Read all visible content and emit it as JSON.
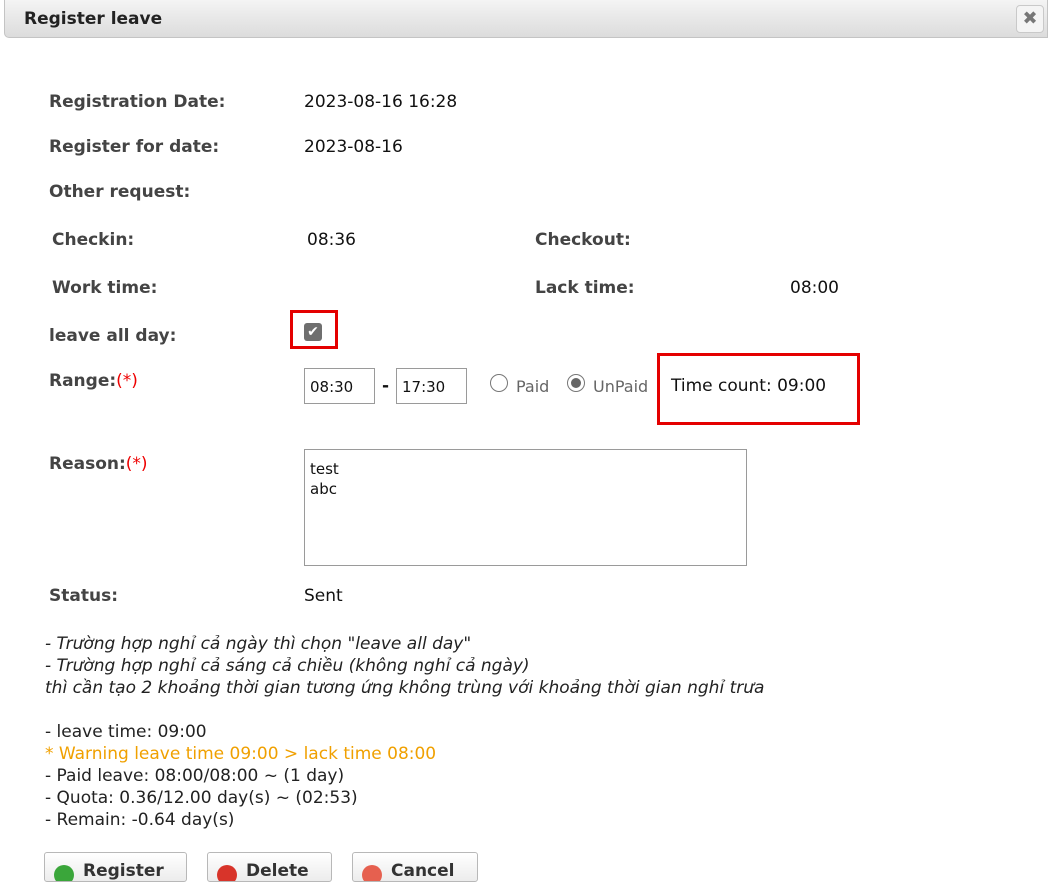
{
  "dialog": {
    "title": "Register leave",
    "close_glyph": "✖"
  },
  "form": {
    "registration_date_label": "Registration Date:",
    "registration_date_value": "2023-08-16 16:28",
    "register_for_date_label": "Register for date:",
    "register_for_date_value": "2023-08-16",
    "other_request_label": "Other request:",
    "checkin_label": "Checkin:",
    "checkin_value": "08:36",
    "checkout_label": "Checkout:",
    "work_time_label": "Work time:",
    "lack_time_label": "Lack time:",
    "lack_time_value": "08:00",
    "leave_all_day_label": "leave all day:",
    "leave_all_day_checked": true,
    "range_label": "Range:",
    "required_mark": "(*)",
    "range_from": "08:30",
    "range_separator": "-",
    "range_to": "17:30",
    "paid_label": "Paid",
    "unpaid_label": "UnPaid",
    "selected_pay_type": "UnPaid",
    "time_count": "Time count: 09:00",
    "reason_label": "Reason:",
    "reason_value": "test\nabc",
    "status_label": "Status:",
    "status_value": "Sent"
  },
  "notes": [
    "- Trường hợp nghỉ cả ngày thì chọn \"leave all day\"",
    "- Trường hợp nghỉ cả sáng cả chiều (không nghỉ cả ngày)",
    "thì cần tạo 2 khoảng thời gian tương ứng không trùng với khoảng thời gian nghỉ trưa"
  ],
  "summary": {
    "leave_time": "- leave time: 09:00",
    "warning": "* Warning leave time 09:00 > lack time 08:00",
    "paid_leave": "- Paid leave: 08:00/08:00 ~ (1 day)",
    "quota": "- Quota: 0.36/12.00 day(s) ~ (02:53)",
    "remain": "- Remain: -0.64 day(s)"
  },
  "buttons": {
    "register": "Register",
    "delete": "Delete",
    "cancel": "Cancel"
  },
  "colors": {
    "highlight": "#e40000",
    "required": "#ee0000",
    "warning": "#f0a000",
    "register_icon": "#3aa63a",
    "delete_icon": "#d8342a",
    "cancel_icon": "#e6604f"
  }
}
